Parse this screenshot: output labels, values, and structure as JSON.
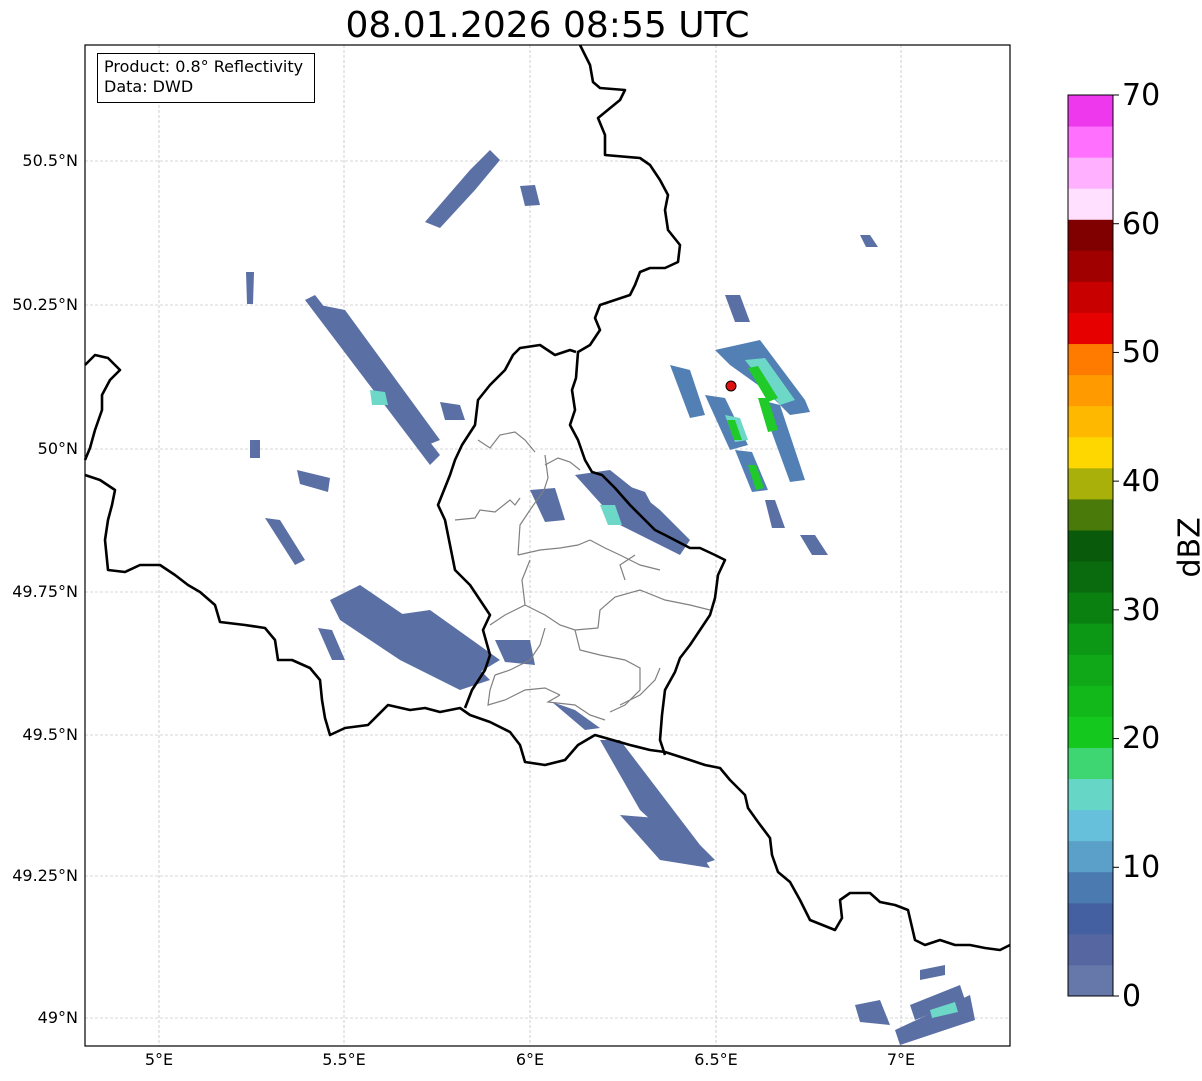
{
  "title": "08.01.2026 08:55 UTC",
  "info": {
    "product": "Product: 0.8° Reflectivity",
    "data": "Data: DWD"
  },
  "map": {
    "extent": {
      "lon": [
        4.8,
        7.3
      ],
      "lat": [
        48.95,
        50.7
      ]
    },
    "gridlines": true,
    "lon_ticks": [
      "5°E",
      "5.5°E",
      "6°E",
      "6.5°E",
      "7°E"
    ],
    "lat_ticks": [
      "49°N",
      "49.25°N",
      "49.5°N",
      "49.75°N",
      "50°N",
      "50.25°N",
      "50.5°N"
    ],
    "radar_site": {
      "lon": 6.547,
      "lat": 50.11,
      "color": "#e01010"
    }
  },
  "colorbar": {
    "label": "dBZ",
    "min": 0,
    "max": 70,
    "tick_labels": [
      "0",
      "10",
      "20",
      "30",
      "40",
      "50",
      "60",
      "70"
    ],
    "colors": [
      "#6677aa",
      "#5566a0",
      "#4460a0",
      "#4a7ab0",
      "#5aa0c8",
      "#66c0dc",
      "#66d6c6",
      "#3dd673",
      "#14c81e",
      "#12b81a",
      "#10a818",
      "#0c9814",
      "#0a8010",
      "#0a6a0e",
      "#0a5a0c",
      "#4a7a0a",
      "#aab00a",
      "#ffd700",
      "#ffb800",
      "#ff9a00",
      "#ff7b00",
      "#e60000",
      "#c80000",
      "#a00000",
      "#800000",
      "#ffe0ff",
      "#ffb0ff",
      "#ff70ff",
      "#ee38ee"
    ]
  }
}
